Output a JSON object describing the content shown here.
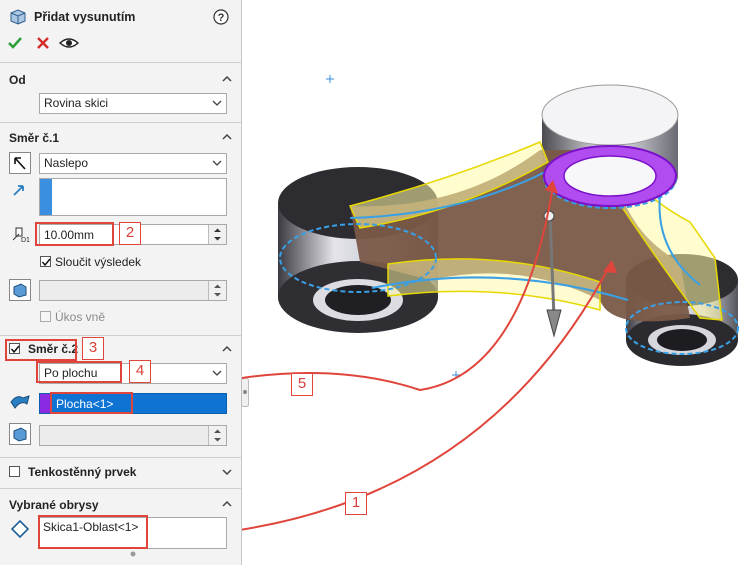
{
  "panel": {
    "title": "Přidat vysunutím",
    "help_icon": "help-icon",
    "actions": {
      "ok_icon": "check-icon",
      "cancel_icon": "close-icon",
      "preview_icon": "eye-icon"
    },
    "from": {
      "header": "Od",
      "value": "Rovina skici"
    },
    "direction1": {
      "header": "Směr č.1",
      "end_condition": "Naslepo",
      "depth": "10.00mm",
      "merge_label": "Sloučit výsledek",
      "merge_checked": true,
      "draft_label": "Úkos vně",
      "draft_checked": false
    },
    "direction2": {
      "header": "Směr č.2",
      "checked": true,
      "end_condition": "Po plochu",
      "face_value": "Plocha<1>"
    },
    "thin": {
      "header": "Tenkostěnný prvek",
      "checked": false
    },
    "contours": {
      "header": "Vybrané obrysy",
      "value": "Skica1-Oblast<1>"
    }
  },
  "callouts": [
    "1",
    "2",
    "3",
    "4",
    "5"
  ],
  "colors": {
    "accent_red": "#e0453c",
    "selection_blue": "#0078d7",
    "face_purple": "#8a2be2",
    "preview_yellow": "#f2e600",
    "edge_blue": "#3aa0e6",
    "body_brown": "#7a5a48"
  }
}
